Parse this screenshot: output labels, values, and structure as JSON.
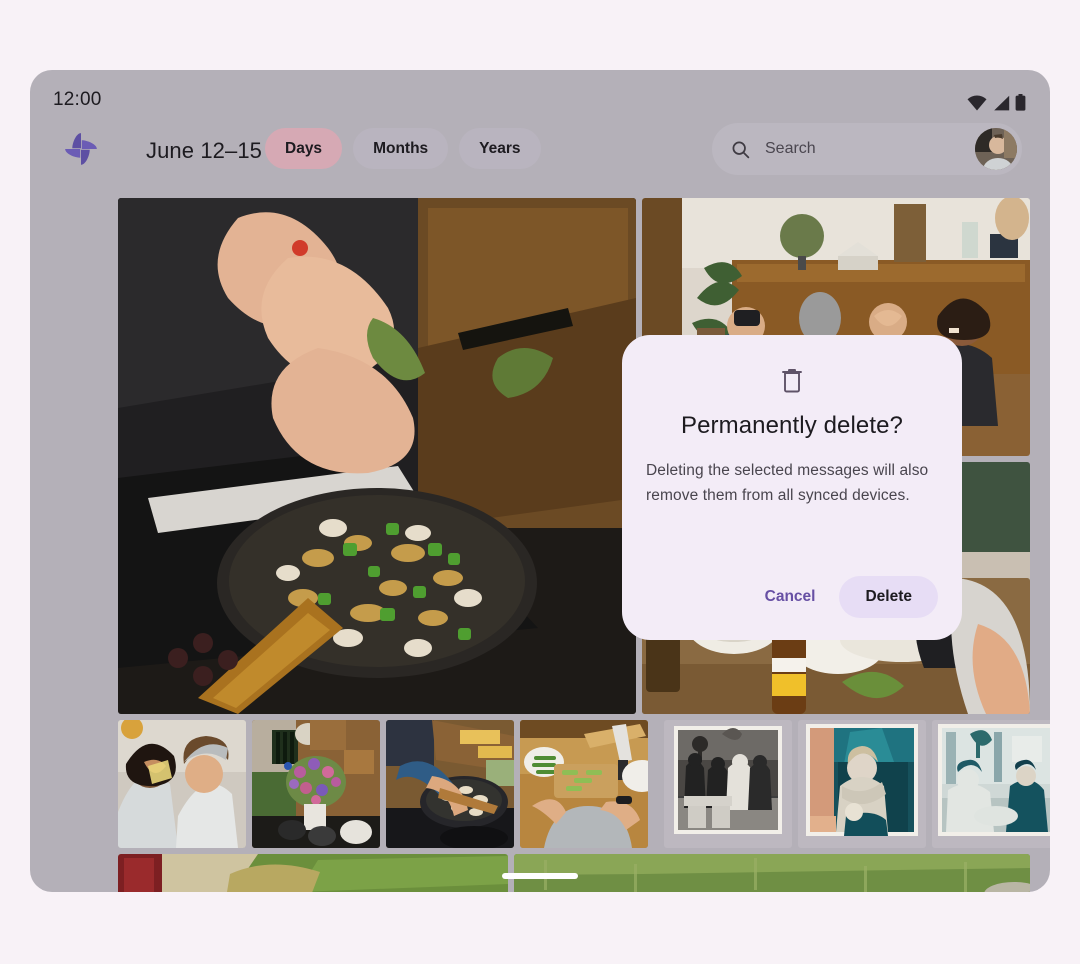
{
  "theme": {
    "page_background": "#f8f2f7",
    "device_frame": "#b4b0b8",
    "chip_selected": "#d6a9b4",
    "chip_default": "#b9b4bf",
    "dialog_surface": "#f3ecf7",
    "accent_purple": "#6750a4",
    "delete_button_bg": "#e7ddf5",
    "on_surface": "#1d1b20",
    "on_surface_variant": "#49454e"
  },
  "status_bar": {
    "time": "12:00",
    "icons": [
      "wifi-icon",
      "cellular-signal-icon",
      "battery-icon"
    ]
  },
  "app_bar": {
    "logo": "google-photos-pinwheel-logo",
    "date_range": "June 12–15",
    "chips": [
      {
        "label": "Days",
        "selected": true
      },
      {
        "label": "Months",
        "selected": false
      },
      {
        "label": "Years",
        "selected": false
      }
    ],
    "search": {
      "icon": "search-icon",
      "placeholder": "Search",
      "value": ""
    },
    "avatar": "user-avatar"
  },
  "photo_grid": {
    "tiles": [
      {
        "name": "photo-cooking-herbs-mushrooms",
        "alt": "Hands sprinkling herbs over a pan of mushrooms"
      },
      {
        "name": "photo-friends-covering-faces",
        "alt": "Group of friends covering their faces on a couch"
      },
      {
        "name": "photo-man-white-shirt",
        "alt": "Man in a white t-shirt"
      },
      {
        "name": "photo-dinner-table-bottle",
        "alt": "Dinner table with a beer bottle and bowls"
      },
      {
        "name": "photo-couple-drinking",
        "alt": "Woman drinking from a glass beside a man in a beanie"
      },
      {
        "name": "photo-flowers-table",
        "alt": "Wildflower bouquet on a wooden table"
      },
      {
        "name": "photo-pan-cooking",
        "alt": "Hand stirring a pan on the stove"
      },
      {
        "name": "photo-cutting-board-cucumber",
        "alt": "Overhead view of cucumbers on a cutting board"
      },
      {
        "name": "photo-vintage-group-bw",
        "alt": "Vintage black and white photo of a group indoors"
      },
      {
        "name": "photo-vintage-portrait-teal",
        "alt": "Vintage teal-toned portrait of a person seated"
      },
      {
        "name": "photo-vintage-living-room",
        "alt": "Vintage teal-toned photo of people in a living room"
      },
      {
        "name": "photo-field-grass-left",
        "alt": "Grassy field partially visible"
      },
      {
        "name": "photo-field-grass-right",
        "alt": "Grassy field partially visible"
      }
    ]
  },
  "dialog": {
    "icon": "trash-can-icon",
    "title": "Permanently delete?",
    "body": "Deleting the selected messages will also remove them from all synced devices.",
    "cancel_label": "Cancel",
    "confirm_label": "Delete"
  },
  "home_indicator": "home-indicator-bar"
}
